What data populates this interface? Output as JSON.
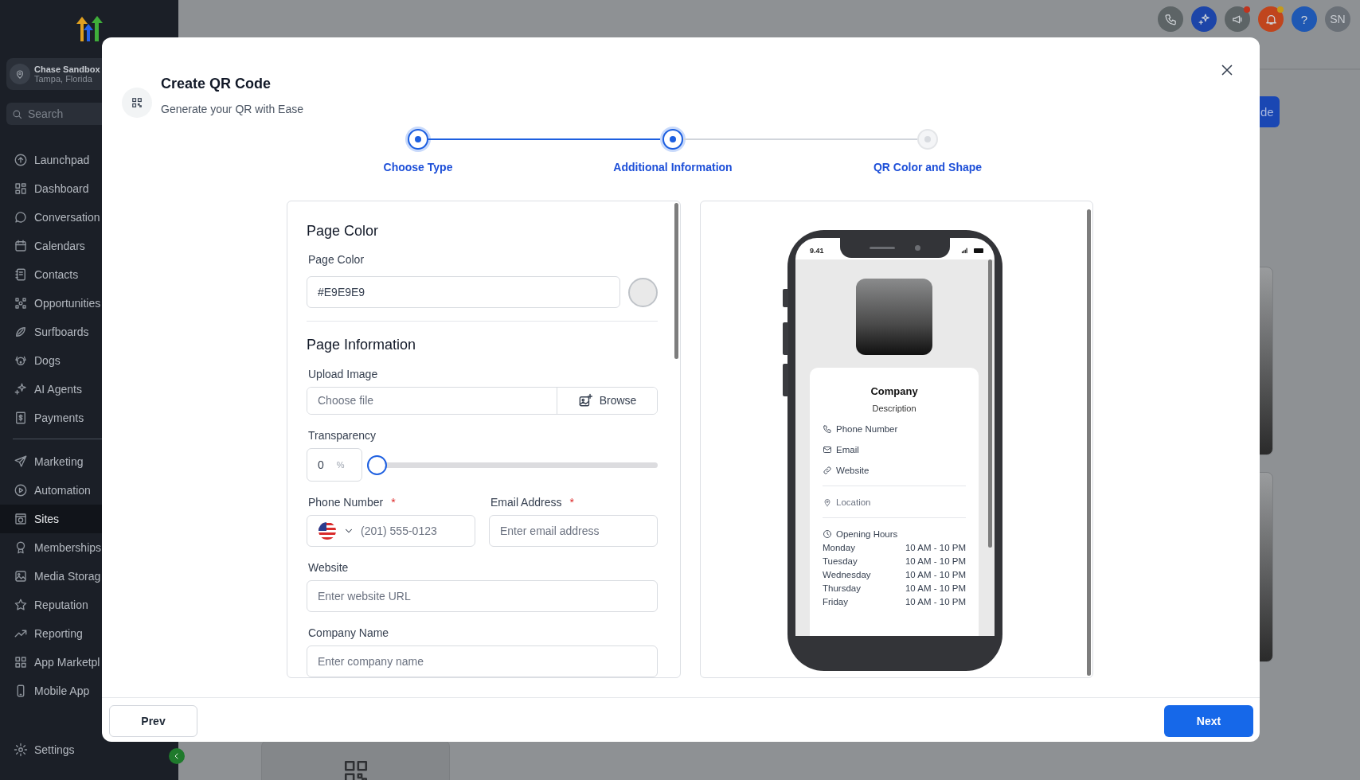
{
  "sidebar": {
    "account": {
      "name": "Chase Sandbox",
      "location": "Tampa, Florida"
    },
    "search": {
      "placeholder": "Search"
    },
    "groups": [
      {
        "items": [
          {
            "label": "Launchpad",
            "selected": false
          },
          {
            "label": "Dashboard",
            "selected": false
          },
          {
            "label": "Conversation",
            "selected": false
          },
          {
            "label": "Calendars",
            "selected": false
          },
          {
            "label": "Contacts",
            "selected": false
          },
          {
            "label": "Opportunities",
            "selected": false
          },
          {
            "label": "Surfboards",
            "selected": false
          },
          {
            "label": "Dogs",
            "selected": false
          },
          {
            "label": "AI Agents",
            "selected": false
          },
          {
            "label": "Payments",
            "selected": false
          }
        ]
      },
      {
        "items": [
          {
            "label": "Marketing",
            "selected": false
          },
          {
            "label": "Automation",
            "selected": false
          },
          {
            "label": "Sites",
            "selected": true
          },
          {
            "label": "Memberships",
            "selected": false
          },
          {
            "label": "Media Storag",
            "selected": false
          },
          {
            "label": "Reputation",
            "selected": false
          },
          {
            "label": "Reporting",
            "selected": false
          },
          {
            "label": "App Marketpl",
            "selected": false
          },
          {
            "label": "Mobile App",
            "selected": false
          }
        ]
      }
    ],
    "settings": {
      "label": "Settings"
    }
  },
  "top_bar": {
    "help_label": "?",
    "avatar_initials": "SN"
  },
  "background": {
    "button_label": "de"
  },
  "dialog": {
    "title": "Create QR Code",
    "subtitle": "Generate your QR with Ease",
    "steps": [
      {
        "label": "Choose Type",
        "reached": true
      },
      {
        "label": "Additional Information",
        "reached": true
      },
      {
        "label": "QR Color and Shape",
        "reached": false
      }
    ],
    "form": {
      "page_color_heading": "Page Color",
      "page_color": {
        "label": "Page Color",
        "value": "#E9E9E9"
      },
      "page_info_heading": "Page Information",
      "upload": {
        "label": "Upload Image",
        "placeholder": "Choose file",
        "button": "Browse"
      },
      "transparency": {
        "label": "Transparency",
        "value": "0",
        "unit": "%",
        "level": 0
      },
      "phone": {
        "label": "Phone Number",
        "required_mark": "*",
        "placeholder": "(201) 555-0123"
      },
      "email": {
        "label": "Email Address",
        "required_mark": "*",
        "placeholder": "Enter email address"
      },
      "website": {
        "label": "Website",
        "placeholder": "Enter website URL"
      },
      "company": {
        "label": "Company Name",
        "placeholder": "Enter company name"
      }
    },
    "preview": {
      "status_time": "9.41",
      "company": "Company",
      "description": "Description",
      "contacts": [
        {
          "label": "Phone Number"
        },
        {
          "label": "Email"
        },
        {
          "label": "Website"
        }
      ],
      "location": "Location",
      "hours_title": "Opening Hours",
      "hours": [
        {
          "day": "Monday",
          "time": "10 AM - 10 PM"
        },
        {
          "day": "Tuesday",
          "time": "10 AM - 10 PM"
        },
        {
          "day": "Wednesday",
          "time": "10 AM - 10 PM"
        },
        {
          "day": "Thursday",
          "time": "10 AM - 10 PM"
        },
        {
          "day": "Friday",
          "time": "10 AM - 10 PM"
        }
      ]
    },
    "buttons": {
      "prev": "Prev",
      "next": "Next"
    }
  }
}
